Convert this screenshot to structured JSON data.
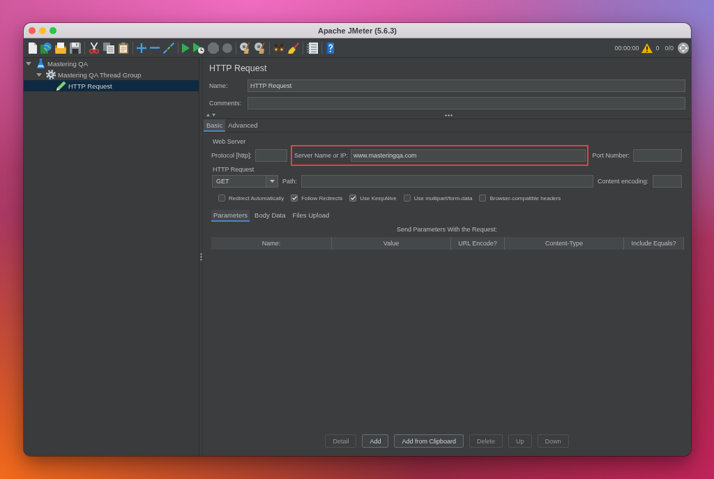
{
  "window": {
    "title": "Apache JMeter (5.6.3)"
  },
  "toolbar": {
    "elapsed": "00:00:00",
    "warnings": "0",
    "threads": "0/0"
  },
  "tree": [
    {
      "label": "Mastering QA",
      "kind": "test_plan",
      "expanded": true,
      "selected": false,
      "children": [
        {
          "label": "Mastering QA Thread Group",
          "kind": "thread_group",
          "expanded": true,
          "selected": false,
          "children": [
            {
              "label": "HTTP Request",
              "kind": "sampler",
              "selected": true
            }
          ]
        }
      ]
    }
  ],
  "editor": {
    "title": "HTTP Request",
    "name": {
      "label": "Name:",
      "value": "HTTP Request"
    },
    "comments": {
      "label": "Comments:"
    }
  },
  "tabs": [
    {
      "label": "Basic",
      "selected": true
    },
    {
      "label": "Advanced",
      "selected": false
    }
  ],
  "web_server": {
    "legend": "Web Server",
    "protocol": {
      "label": "Protocol [http]:"
    },
    "server": {
      "label": "Server Name or IP:",
      "value": "www.masteringqa.com",
      "highlighted": true
    },
    "port": {
      "label": "Port Number:"
    }
  },
  "http_request": {
    "legend": "HTTP Request",
    "method": "GET",
    "path": {
      "label": "Path:"
    },
    "encoding": {
      "label": "Content encoding:"
    }
  },
  "options": [
    {
      "label": "Redirect Automatically",
      "checked": false
    },
    {
      "label": "Follow Redirects",
      "checked": true
    },
    {
      "label": "Use KeepAlive",
      "checked": true
    },
    {
      "label": "Use multipart/form-data",
      "checked": false
    },
    {
      "label": "Browser-compatible headers",
      "checked": false
    }
  ],
  "sub_tabs": [
    {
      "label": "Parameters",
      "selected": true
    },
    {
      "label": "Body Data",
      "selected": false
    },
    {
      "label": "Files Upload",
      "selected": false
    }
  ],
  "parameters": {
    "caption": "Send Parameters With the Request:",
    "columns": [
      "Name:",
      "Value",
      "URL Encode?",
      "Content-Type",
      "Include Equals?"
    ]
  },
  "buttons": [
    {
      "label": "Detail",
      "disabled": true
    },
    {
      "label": "Add",
      "disabled": false
    },
    {
      "label": "Add from Clipboard",
      "disabled": false
    },
    {
      "label": "Delete",
      "disabled": true
    },
    {
      "label": "Up",
      "disabled": true
    },
    {
      "label": "Down",
      "disabled": true
    }
  ]
}
